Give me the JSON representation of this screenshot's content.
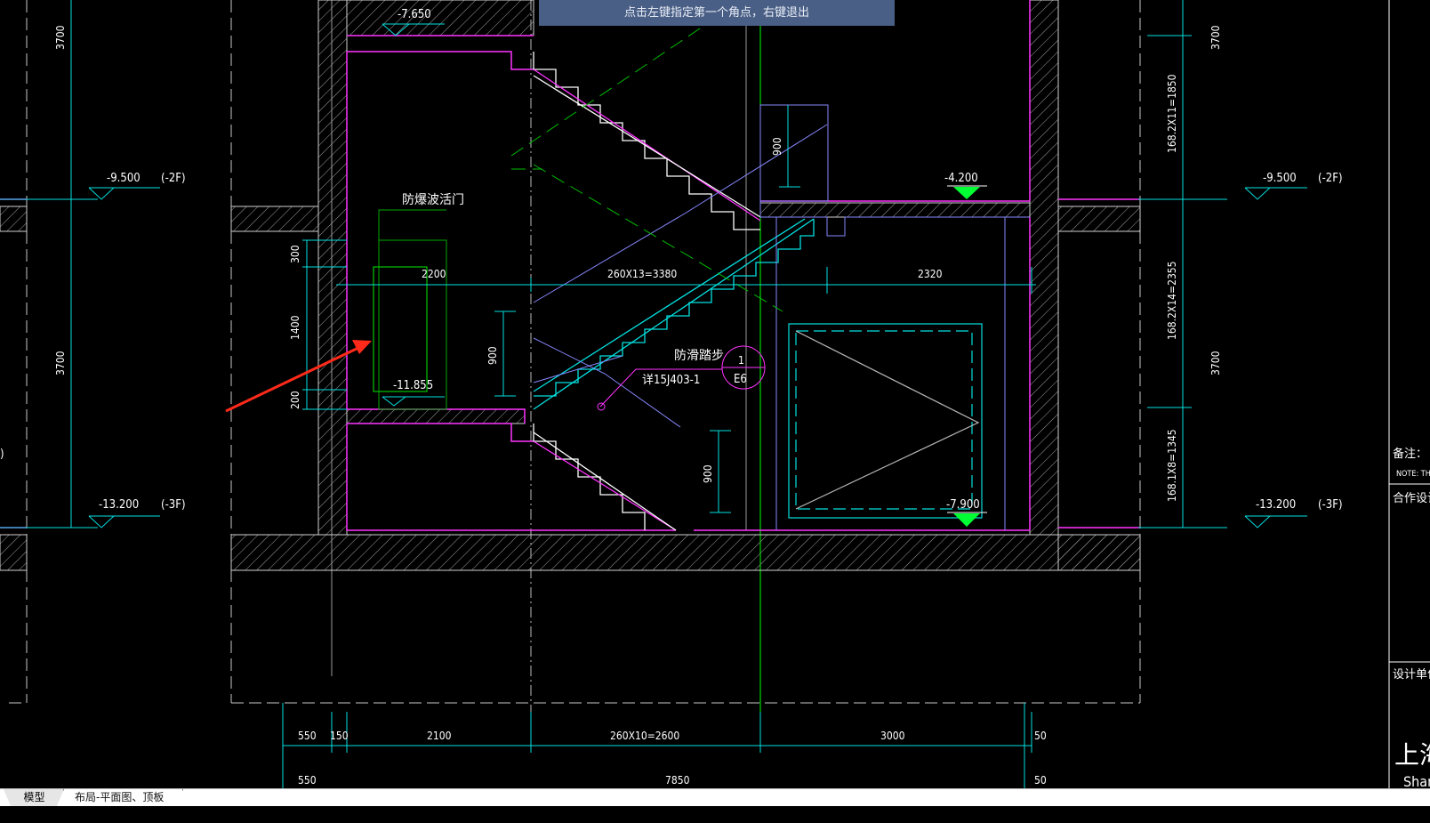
{
  "command_tip": "点击左键指定第一个角点，右键退出",
  "tabs": [
    {
      "label": "模型",
      "active": true
    },
    {
      "label": "布局-平面图、顶板图",
      "active": false
    }
  ],
  "labels": {
    "door": "防爆波活门",
    "antislip": "防滑踏步",
    "detail_ref": "详15J403-1",
    "callout_num": "1",
    "callout_sheet": "E6",
    "level_top": "-7.650",
    "level_left_2f": "-9.500",
    "floor_2f": "(-2F)",
    "level_left_3f": "-13.200",
    "floor_3f": "(-3F)",
    "level_door": "-11.855",
    "level_green_top": "-4.200",
    "level_green_bottom": "-7.900",
    "level_right_2f": "-9.500",
    "level_right_3f": "-13.200"
  },
  "dims": {
    "left_top": "3700",
    "left_mid": "3700",
    "right_top": "3700",
    "right_mid": "3700",
    "seg1": "168.2X11=1850",
    "seg2": "168.2X14=2355",
    "seg3": "168.1X8=1345",
    "d300": "300",
    "d1400": "1400",
    "d200": "200",
    "d900a": "900",
    "d900b": "900",
    "d900c": "900",
    "h2200": "2200",
    "h3380": "260X13=3380",
    "h2320": "2320",
    "b550": "550",
    "b150": "150",
    "b2100": "2100",
    "b2600": "260X10=2600",
    "b3000": "3000",
    "b50": "50",
    "c550": "550",
    "c7850": "7850",
    "c50": "50"
  },
  "title_block": {
    "note_cn": "备注：",
    "note_en": "NOTE: TH",
    "cooperate": "合作设计",
    "design_unit": "设计单位",
    "company_cn": "上海",
    "company_en": "Shan"
  },
  "colors": {
    "wall": "#ff33ff",
    "hatch": "#b0b0b0",
    "cyan": "#00e0e0",
    "green": "#00ff00",
    "white": "#ffffff",
    "arrow": "#ff2a1a",
    "purple": "#7070ff",
    "tip_bg": "#4a5f86"
  }
}
